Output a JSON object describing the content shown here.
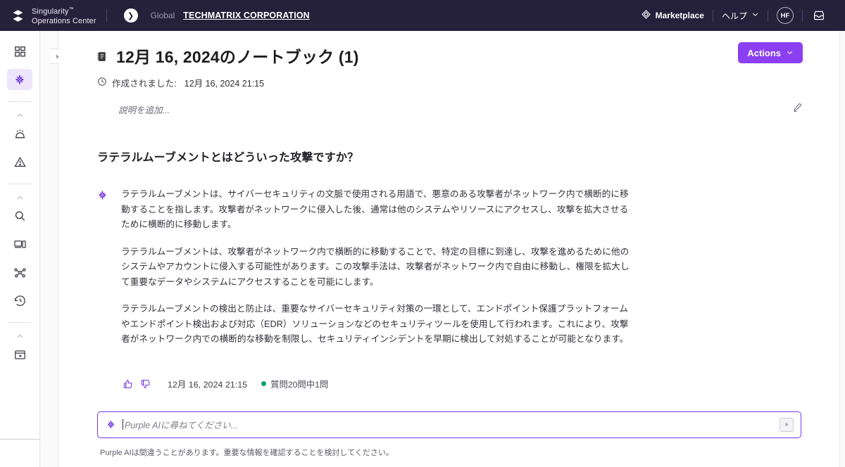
{
  "topbar": {
    "product_line1": "Singularity",
    "product_tm": "™",
    "product_line2": "Operations Center",
    "scope": "Global",
    "organization": "TECHMATRIX CORPORATION",
    "marketplace": "Marketplace",
    "help": "ヘルプ",
    "avatar_initials": "HF",
    "logo_icon": "singularity-logo-icon",
    "crumb_arrow_icon": "chevron-right-circle-icon",
    "marketplace_icon": "marketplace-diamond-icon",
    "help_chevron_icon": "chevron-down-icon",
    "inbox_icon": "inbox-icon",
    "brand_bg": "#26213a"
  },
  "sidebar": {
    "items": [
      {
        "name": "dashboard",
        "icon": "grid-squares-icon",
        "active": false
      },
      {
        "name": "purple-ai",
        "icon": "purple-ai-star-icon",
        "active": true
      },
      {
        "name": "alerts",
        "icon": "siren-icon",
        "active": false
      },
      {
        "name": "incidents",
        "icon": "warning-triangle-icon",
        "active": false
      },
      {
        "name": "search",
        "icon": "magnifier-icon",
        "active": false
      },
      {
        "name": "devices",
        "icon": "monitor-icon",
        "active": false
      },
      {
        "name": "graph",
        "icon": "node-graph-icon",
        "active": false
      },
      {
        "name": "history",
        "icon": "clock-rewind-icon",
        "active": false
      },
      {
        "name": "collapse-panel",
        "icon": "panel-collapse-icon",
        "active": false
      }
    ],
    "collapse_chevron_icon": "chevron-up-icon",
    "panel_toggle_icon": "panel-expand-icon",
    "active_bg": "#ece5fb",
    "active_fg": "#6b2fd9"
  },
  "page": {
    "notebook_icon": "notebook-icon",
    "title": "12月 16, 2024のノートブック (1)",
    "actions_label": "Actions",
    "actions_chevron_icon": "chevron-down-icon",
    "actions_color": "#8b3ff0",
    "clock_icon": "clock-icon",
    "created_label": "作成されました:",
    "created_value": "12月 16, 2024 21:15",
    "description_placeholder": "説明を追加...",
    "description_edit_icon": "pencil-icon"
  },
  "conversation": {
    "question": "ラテラルムーブメントとはどういった攻撃ですか？",
    "ai_icon": "purple-ai-star-icon",
    "answer_paragraphs": [
      "ラテラルムーブメントは、サイバーセキュリティの文脈で使用される用語で、悪意のある攻撃者がネットワーク内で横断的に移動することを指します。攻撃者がネットワークに侵入した後、通常は他のシステムやリソースにアクセスし、攻撃を拡大させるために横断的に移動します。",
      "ラテラルムーブメントは、攻撃者がネットワーク内で横断的に移動することで、特定の目標に到達し、攻撃を進めるために他のシステムやアカウントに侵入する可能性があります。この攻撃手法は、攻撃者がネットワーク内で自由に移動し、権限を拡大して重要なデータやシステムにアクセスすることを可能にします。",
      "ラテラルムーブメントの検出と防止は、重要なサイバーセキュリティ対策の一環として、エンドポイント保護プラットフォームやエンドポイント検出および対応（EDR）ソリューションなどのセキュリティツールを使用して行われます。これにより、攻撃者がネットワーク内での横断的な移動を制限し、セキュリティインシデントを早期に検出して対処することが可能となります。"
    ],
    "thumbs_up_icon": "thumbs-up-icon",
    "thumbs_down_icon": "thumbs-down-icon",
    "answer_timestamp": "12月 16, 2024 21:15",
    "quota_text": "質問20問中1問",
    "quota_dot_color": "#0f9d6e"
  },
  "prompt": {
    "ai_icon": "purple-ai-star-icon",
    "placeholder": "Purple AIに尋ねてください...",
    "value": "",
    "send_icon": "send-arrow-icon",
    "border_color": "#7b3fe4",
    "disclaimer": "Purple AIは間違うことがあります。重要な情報を確認することを検討してください。"
  }
}
